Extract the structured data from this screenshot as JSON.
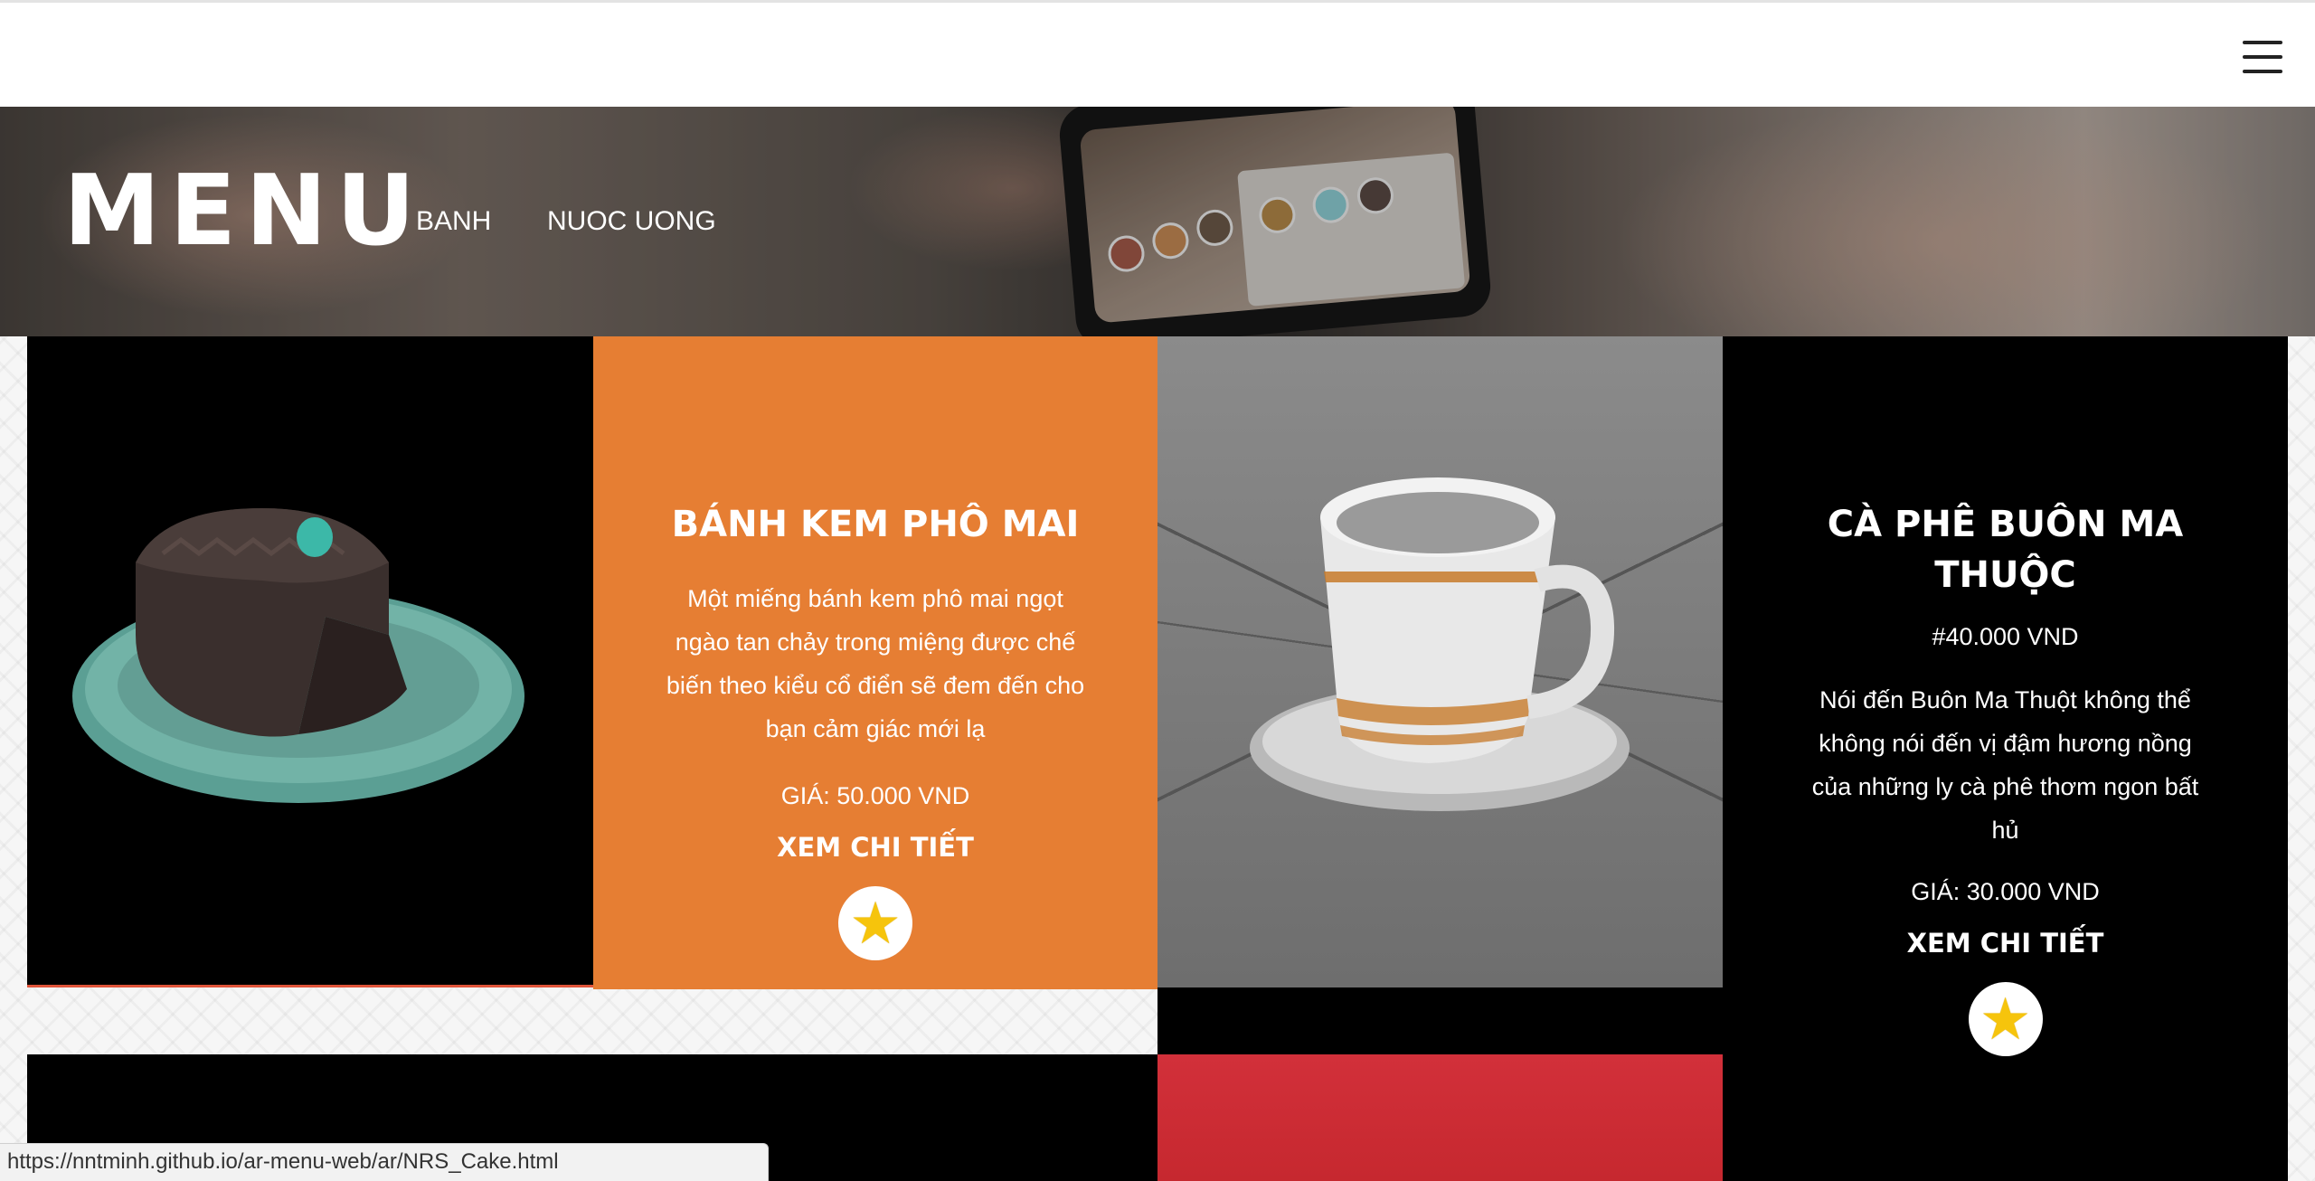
{
  "header": {
    "menu_icon": "hamburger-icon"
  },
  "hero": {
    "title": "MENU",
    "nav": [
      {
        "label": "BANH"
      },
      {
        "label": "NUOC UONG"
      }
    ]
  },
  "products": [
    {
      "name": "BÁNH KEM PHÔ MAI",
      "description": "Một miếng bánh kem phô mai ngọt ngào tan chảy trong miệng được chế biến theo kiểu cổ điển sẽ đem đến cho bạn cảm giác mới lạ",
      "price": "GIÁ: 50.000 VND",
      "detail_label": "XEM CHI TIẾT",
      "favorite_icon": "star-icon"
    },
    {
      "name": "CÀ PHÊ BUÔN MA THUỘC",
      "tag": "#40.000 VND",
      "description": "Nói đến Buôn Ma Thuột không thể không nói đến vị đậm hương nồng của những ly cà phê thơm ngon bất hủ",
      "price": "GIÁ: 30.000 VND",
      "detail_label": "XEM CHI TIẾT",
      "favorite_icon": "star-icon"
    }
  ],
  "status_bar": {
    "url": "https://nntminh.github.io/ar-menu-web/ar/NRS_Cake.html"
  },
  "colors": {
    "accent_orange": "#e67e33",
    "tile_black": "#000000",
    "tile_red": "#d2303a",
    "star": "#f6c40c"
  }
}
